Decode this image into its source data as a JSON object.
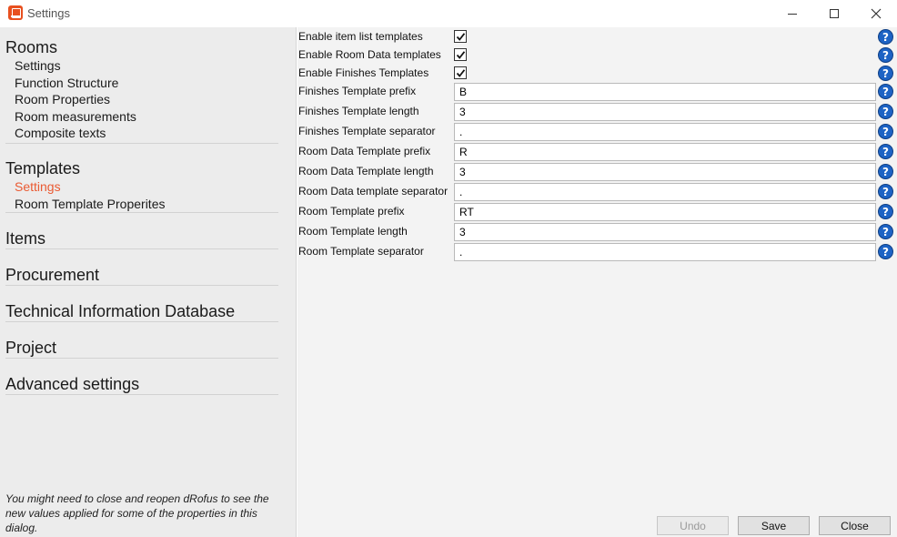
{
  "window": {
    "title": "Settings"
  },
  "sidebar": {
    "sections": [
      {
        "title": "Rooms",
        "items": [
          {
            "label": "Settings"
          },
          {
            "label": "Function Structure"
          },
          {
            "label": "Room Properties"
          },
          {
            "label": "Room measurements"
          },
          {
            "label": "Composite texts"
          }
        ]
      },
      {
        "title": "Templates",
        "items": [
          {
            "label": "Settings",
            "active": true
          },
          {
            "label": "Room Template Properites"
          }
        ]
      },
      {
        "title": "Items",
        "items": []
      },
      {
        "title": "Procurement",
        "items": []
      },
      {
        "title": "Technical Information Database",
        "items": []
      },
      {
        "title": "Project",
        "items": []
      },
      {
        "title": "Advanced settings",
        "items": []
      }
    ],
    "note": "You might need to close and reopen dRofus to see the new values applied for some of the properties in this dialog.",
    "active_color": "#ea5a32"
  },
  "settings": [
    {
      "label": "Enable item list templates",
      "type": "checkbox",
      "checked": true
    },
    {
      "label": "Enable Room Data templates",
      "type": "checkbox",
      "checked": true
    },
    {
      "label": "Enable Finishes Templates",
      "type": "checkbox",
      "checked": true
    },
    {
      "label": "Finishes Template prefix",
      "type": "text",
      "value": "B"
    },
    {
      "label": "Finishes Template length",
      "type": "text",
      "value": "3"
    },
    {
      "label": "Finishes Template separator",
      "type": "text",
      "value": "."
    },
    {
      "label": "Room Data Template prefix",
      "type": "text",
      "value": "R"
    },
    {
      "label": "Room Data Template length",
      "type": "text",
      "value": "3"
    },
    {
      "label": "Room Data template separator",
      "type": "text",
      "value": "."
    },
    {
      "label": "Room Template prefix",
      "type": "text",
      "value": "RT"
    },
    {
      "label": "Room Template length",
      "type": "text",
      "value": "3"
    },
    {
      "label": "Room Template separator",
      "type": "text",
      "value": "."
    }
  ],
  "help_icon": {
    "glyph": "?",
    "color": "#1d63c4"
  },
  "buttons": {
    "undo": "Undo",
    "save": "Save",
    "close": "Close"
  }
}
